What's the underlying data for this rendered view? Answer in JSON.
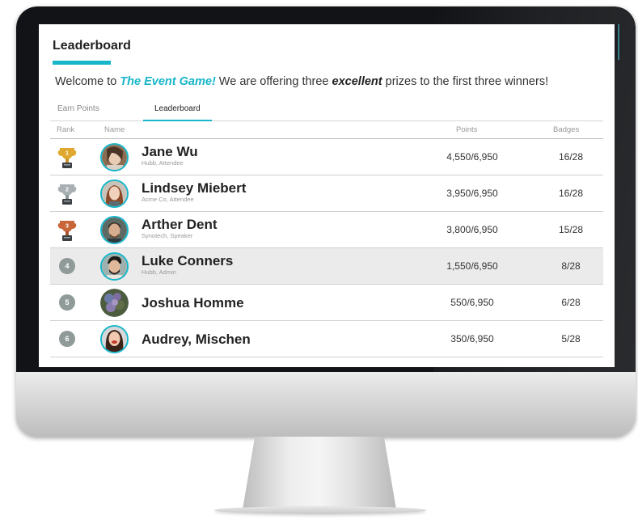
{
  "page": {
    "title": "Leaderboard",
    "welcome_prefix": "Welcome to ",
    "welcome_game": "The Event Game!",
    "welcome_middle": " We are offering three ",
    "welcome_emph": "excellent",
    "welcome_suffix": " prizes to the first three winners!"
  },
  "tabs": [
    {
      "label": "Earn Points",
      "active": false
    },
    {
      "label": "Leaderboard",
      "active": true
    }
  ],
  "columns": {
    "rank": "Rank",
    "name": "Name",
    "points": "Points",
    "badges": "Badges"
  },
  "rows": [
    {
      "rank": "1",
      "rank_style": "trophy-gold",
      "name": "Jane Wu",
      "subtitle": "Hubb, Attendee",
      "points": "4,550/6,950",
      "badges": "16/28"
    },
    {
      "rank": "2",
      "rank_style": "trophy-silver",
      "name": "Lindsey Miebert",
      "subtitle": "Acme Co, Attendee",
      "points": "3,950/6,950",
      "badges": "16/28"
    },
    {
      "rank": "3",
      "rank_style": "trophy-bronze",
      "name": "Arther Dent",
      "subtitle": "Synotech, Speaker",
      "points": "3,800/6,950",
      "badges": "15/28"
    },
    {
      "rank": "4",
      "rank_style": "circle",
      "name": "Luke Conners",
      "subtitle": "Hubb, Admin",
      "points": "1,550/6,950",
      "badges": "8/28",
      "highlighted": true
    },
    {
      "rank": "5",
      "rank_style": "circle",
      "name": "Joshua Homme",
      "subtitle": "",
      "points": "550/6,950",
      "badges": "6/28"
    },
    {
      "rank": "6",
      "rank_style": "circle",
      "name": "Audrey, Mischen",
      "subtitle": "",
      "points": "350/6,950",
      "badges": "5/28"
    }
  ],
  "colors": {
    "accent": "#17b6c9",
    "gold": "#e0a82e",
    "silver": "#a9b0b3",
    "bronze": "#c8663a",
    "rank_circle": "#8f9a99"
  }
}
